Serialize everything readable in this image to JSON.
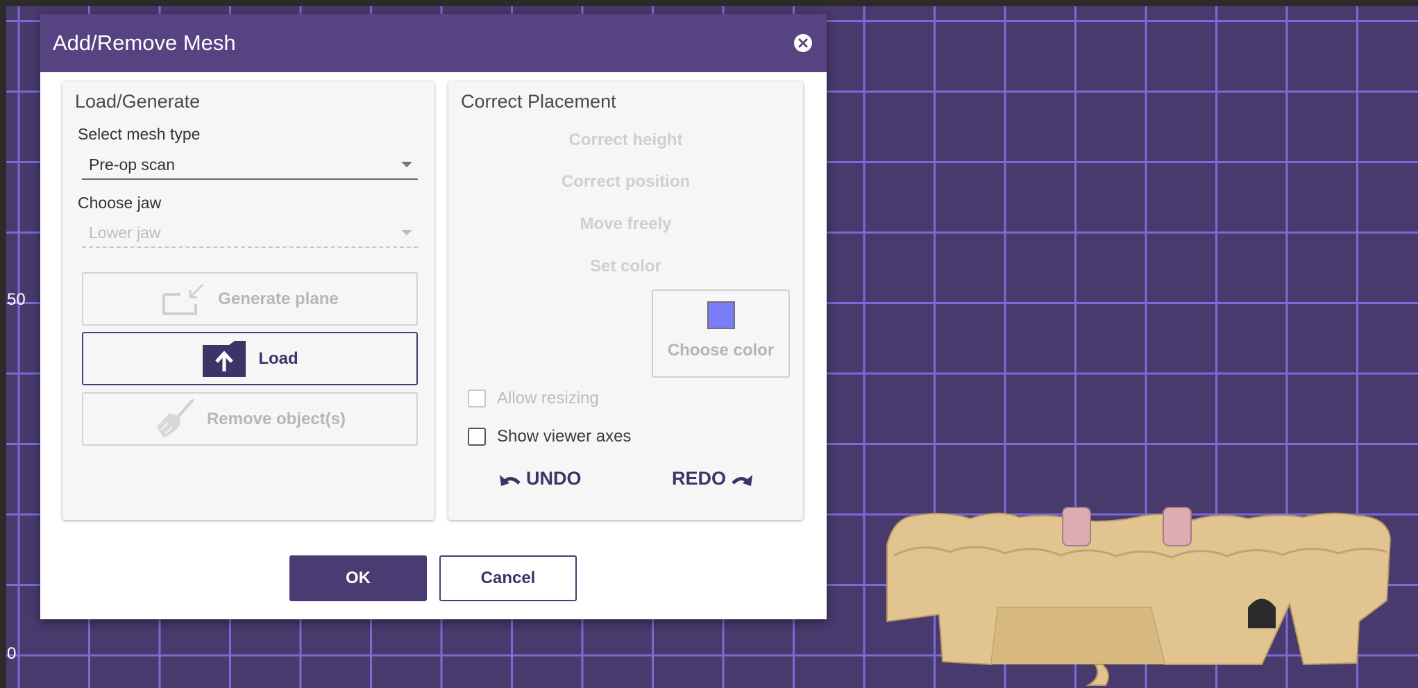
{
  "dialog": {
    "title": "Add/Remove Mesh",
    "close_icon": "close-circle-icon",
    "ok_label": "OK",
    "cancel_label": "Cancel"
  },
  "load_generate": {
    "title": "Load/Generate",
    "mesh_type_label": "Select mesh type",
    "mesh_type_value": "Pre-op scan",
    "jaw_label": "Choose jaw",
    "jaw_value": "Lower jaw",
    "generate_plane_label": "Generate plane",
    "load_label": "Load",
    "remove_label": "Remove object(s)"
  },
  "correct_placement": {
    "title": "Correct Placement",
    "actions": [
      "Correct height",
      "Correct position",
      "Move freely",
      "Set color"
    ],
    "choose_color_label": "Choose color",
    "swatch_color": "#7b7cf7",
    "allow_resizing_label": "Allow resizing",
    "allow_resizing_checked": false,
    "show_axes_label": "Show viewer axes",
    "show_axes_checked": false,
    "undo_label": "UNDO",
    "redo_label": "REDO"
  },
  "viewer": {
    "axis_labels": [
      "50",
      "0"
    ],
    "colors": {
      "background": "#483a6d",
      "grid": "#7d6ad6",
      "model": "#e1c48f",
      "implant": "#dcaeb3"
    }
  }
}
